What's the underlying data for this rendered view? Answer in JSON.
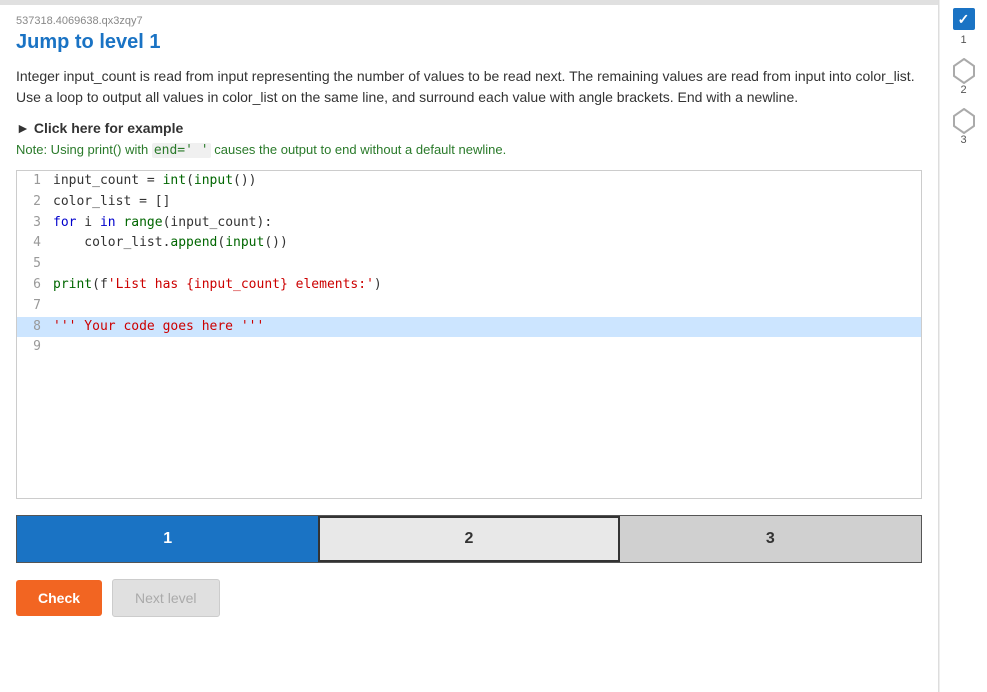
{
  "meta": {
    "id": "537318.4069638.qx3zqy7"
  },
  "header": {
    "title": "Jump to level 1"
  },
  "description": "Integer input_count is read from input representing the number of values to be read next. The remaining values are read from input into color_list. Use a loop to output all values in color_list on the same line, and surround each value with angle brackets. End with a newline.",
  "example": {
    "toggle_label": "Click here for example",
    "note": "Note: Using print() with end=' ' causes the output to end without a default newline."
  },
  "code": {
    "lines": [
      {
        "num": 1,
        "content": "input_count = int(input())",
        "highlighted": false
      },
      {
        "num": 2,
        "content": "color_list = []",
        "highlighted": false
      },
      {
        "num": 3,
        "content": "for i in range(input_count):",
        "highlighted": false
      },
      {
        "num": 4,
        "content": "    color_list.append(input())",
        "highlighted": false
      },
      {
        "num": 5,
        "content": "",
        "highlighted": false
      },
      {
        "num": 6,
        "content": "print(f'List has {input_count} elements:')",
        "highlighted": false
      },
      {
        "num": 7,
        "content": "",
        "highlighted": false
      },
      {
        "num": 8,
        "content": "''' Your code goes here '''",
        "highlighted": true
      },
      {
        "num": 9,
        "content": "",
        "highlighted": false
      }
    ]
  },
  "tabs": [
    {
      "label": "1",
      "state": "active"
    },
    {
      "label": "2",
      "state": "selected-outline"
    },
    {
      "label": "3",
      "state": "inactive"
    }
  ],
  "actions": {
    "check_label": "Check",
    "next_label": "Next level"
  },
  "sidebar": {
    "items": [
      {
        "label": "1",
        "state": "checked"
      },
      {
        "label": "2",
        "state": "pentagon"
      },
      {
        "label": "3",
        "state": "pentagon"
      }
    ]
  }
}
